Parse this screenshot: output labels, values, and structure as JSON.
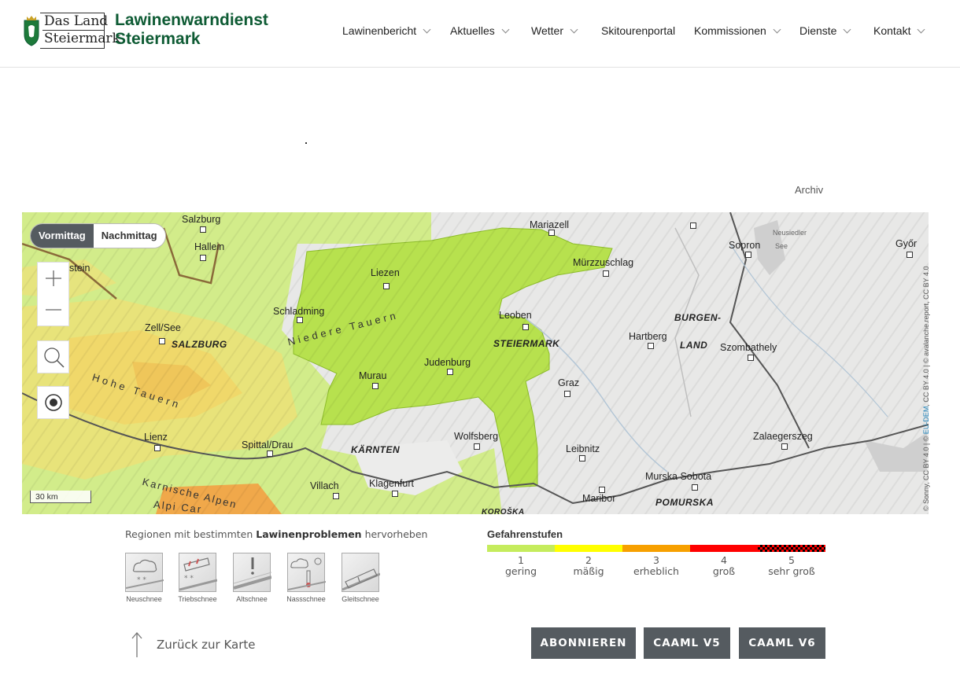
{
  "brand": {
    "logo_line1": "Das Land",
    "logo_line2": "Steiermark",
    "site_title_line1": "Lawinenwarndienst",
    "site_title_line2": "Steiermark",
    "brand_color": "#0e5b34"
  },
  "nav": {
    "items": [
      {
        "label": "Lawinenbericht",
        "dropdown": true
      },
      {
        "label": "Aktuelles",
        "dropdown": true
      },
      {
        "label": "Wetter",
        "dropdown": true
      },
      {
        "label": "Skitourenportal",
        "dropdown": false
      },
      {
        "label": "Kommissionen",
        "dropdown": true
      },
      {
        "label": "Dienste",
        "dropdown": true
      },
      {
        "label": "Kontakt",
        "dropdown": true
      }
    ]
  },
  "archiv_label": "Archiv",
  "map": {
    "toggle": {
      "morning": "Vormittag",
      "afternoon": "Nachmittag",
      "active": "morning"
    },
    "controls": {
      "zoom_in": "plus-icon",
      "zoom_out": "minus-icon",
      "search": "search-icon",
      "locate": "locate-icon"
    },
    "scale_label": "30 km",
    "attribution": {
      "part1": "© Sonny, CC BY 4.0 | © ",
      "link": "EU-DEM",
      "part2": ", CC BY 4.0 | © avalanche.report, CC BY 4.0"
    },
    "cities": {
      "salzburg": "Salzburg",
      "hallein": "Hallein",
      "stein": "stein",
      "zell": "Zell/See",
      "schladming": "Schladming",
      "liezen": "Liezen",
      "mariazell": "Mariazell",
      "muerz": "Mürzzuschlag",
      "leoben": "Leoben",
      "judenburg": "Judenburg",
      "murau": "Murau",
      "graz": "Graz",
      "hartberg": "Hartberg",
      "szombathely": "Szombathely",
      "sopron": "Sopron",
      "gyor": "Győr",
      "lienz": "Lienz",
      "spittal": "Spittal/Drau",
      "villach": "Villach",
      "klagenfurt": "Klagenfurt",
      "wolfsberg": "Wolfsberg",
      "leibnitz": "Leibnitz",
      "maribor": "Maribor",
      "murska": "Murska Sobota",
      "zalaeg": "Zalaegerszeg",
      "neusiedler": "Neusiedler",
      "see": "See"
    },
    "regions": {
      "salzburg": "SALZBURG",
      "steiermark": "STEIERMARK",
      "kaernten": "KÄRNTEN",
      "burgen": "BURGEN-",
      "land": "LAND",
      "pomurska": "POMURSKA",
      "koroska": "KOROŠKA"
    },
    "ranges": {
      "niedere": "Niedere Tauern",
      "hohe": "Hohe Tauern",
      "karnische": "Karnische Alpen",
      "alpi": "Alpi Car"
    }
  },
  "problems": {
    "title_prefix": "Regionen mit bestimmten ",
    "title_bold": "Lawinenproblemen",
    "title_suffix": " hervorheben",
    "items": [
      {
        "label": "Neuschnee",
        "icon": "new-snow-icon"
      },
      {
        "label": "Triebschnee",
        "icon": "wind-slab-icon"
      },
      {
        "label": "Altschnee",
        "icon": "persistent-weak-layer-icon"
      },
      {
        "label": "Nassschnee",
        "icon": "wet-snow-icon"
      },
      {
        "label": "Gleitschnee",
        "icon": "gliding-snow-icon"
      }
    ]
  },
  "danger": {
    "title": "Gefahrenstufen",
    "levels": [
      {
        "num": "1",
        "label": "gering",
        "color": "#c5ec5d"
      },
      {
        "num": "2",
        "label": "mäßig",
        "color": "#ffff00"
      },
      {
        "num": "3",
        "label": "erheblich",
        "color": "#f7a000"
      },
      {
        "num": "4",
        "label": "groß",
        "color": "#ff0000"
      },
      {
        "num": "5",
        "label": "sehr groß",
        "color": "checkered-red-black"
      }
    ]
  },
  "back_label": "Zurück zur Karte",
  "buttons": {
    "subscribe": "ABONNIEREN",
    "caaml5": "CAAML V5",
    "caaml6": "CAAML V6"
  }
}
